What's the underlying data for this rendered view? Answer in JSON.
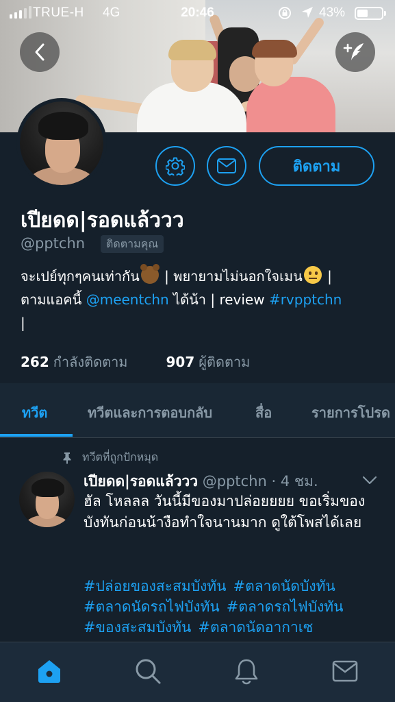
{
  "status_bar": {
    "carrier": "TRUE-H",
    "network": "4G",
    "time": "20:46",
    "battery_percent": "43%",
    "battery_level": 0.43
  },
  "profile": {
    "name": "เปียดด|รอดแล้ววว",
    "handle": "@pptchn",
    "follows_you_label": "ติดตามคุณ",
    "follow_button_label": "ติดตาม",
    "bio": {
      "line1_a": "จะเปย์ทุกๆคนเท่ากัน",
      "line1_b": " | พยายามไม่นอกใจเมน",
      "line1_c": " |",
      "line2_a": "ตามแอคนี้ ",
      "line2_mention": "@meentchn",
      "line2_b": " ได้น้า | review ",
      "line2_hashtag": "#rvpptchn",
      "line3": "|"
    },
    "following_count": "262",
    "following_label": "กำลังติดตาม",
    "followers_count": "907",
    "followers_label": "ผู้ติดตาม"
  },
  "tabs": [
    {
      "label": "ทวีต",
      "active": true
    },
    {
      "label": "ทวีตและการตอบกลับ",
      "active": false
    },
    {
      "label": "สื่อ",
      "active": false
    },
    {
      "label": "รายการโปรด",
      "active": false
    }
  ],
  "pinned_tweet": {
    "pinned_label": "ทวีตที่ถูกปักหมุด",
    "author_name": "เปียดด|รอดแล้ววว",
    "meta": " @pptchn · 4 ชม.",
    "text": "ฮัล โหลลล วันนี้มีของมาปล่อยยยย ขอเริ่มของบังทันก่อนน้างือทำใจนานมาก ดูใต้โพสได้เลย",
    "hashtags": [
      "#ปล่อยของสะสมบังทัน",
      "#ตลาดนัดบังทัน",
      "#ตลาดนัดรถไฟบังทัน",
      "#ตลาดรถไฟบังทัน",
      "#ของสะสมบังทัน",
      "#ตลาดนัดอากาเซ"
    ]
  },
  "colors": {
    "background": "#15202b",
    "accent": "#1da1f2",
    "secondary_text": "#8899a6"
  },
  "icons": {
    "back": "chevron-left-icon",
    "compose": "quill-plus-icon",
    "settings": "gear-icon",
    "message": "envelope-icon",
    "pin": "pin-icon",
    "caret": "chevron-down-icon",
    "home": "home-icon",
    "search": "search-icon",
    "notifications": "bell-icon",
    "messages": "envelope-icon"
  }
}
